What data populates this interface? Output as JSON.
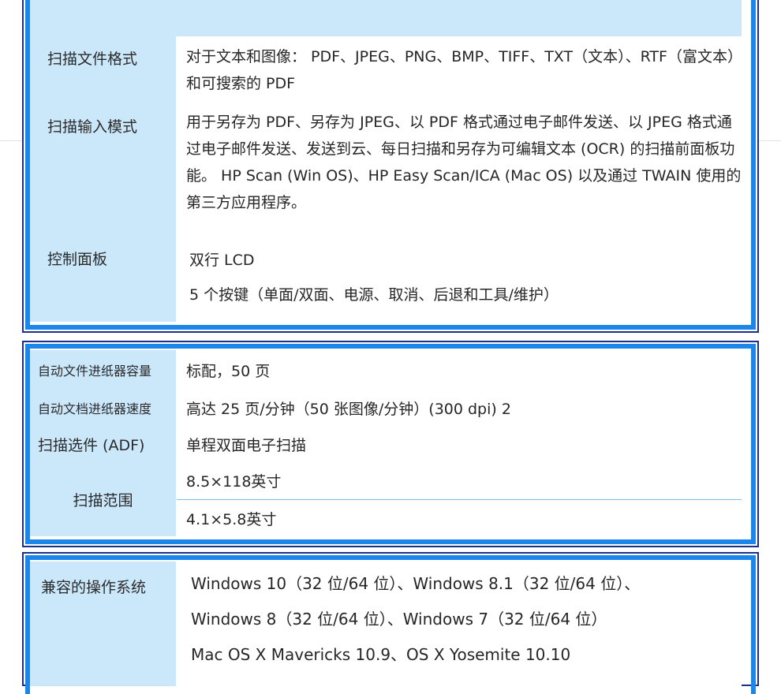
{
  "spec_panel_1": {
    "scan_file_format": {
      "label": "扫描文件格式",
      "value": "对于文本和图像： PDF、JPEG、PNG、BMP、TIFF、TXT（文本）、RTF（富文本）和可搜索的 PDF"
    },
    "scan_input_mode": {
      "label": "扫描输入模式",
      "value": "用于另存为 PDF、另存为 JPEG、以 PDF 格式通过电子邮件发送、以 JPEG 格式通过电子邮件发送、发送到云、每日扫描和另存为可编辑文本 (OCR) 的扫描前面板功能。 HP Scan (Win OS)、HP Easy Scan/ICA (Mac OS) 以及通过 TWAIN 使用的第三方应用程序。"
    },
    "control_panel": {
      "label": "控制面板",
      "lines": [
        "双行 LCD",
        "5 个按键（单面/双面、电源、取消、后退和工具/维护）"
      ]
    }
  },
  "spec_panel_2": {
    "adf_capacity": {
      "label": "自动文件进纸器容量",
      "value": "标配，50 页"
    },
    "adf_speed": {
      "label": "自动文档进纸器速度",
      "value": "高达 25 页/分钟（50 张图像/分钟）(300 dpi) 2"
    },
    "scan_option": {
      "label": "扫描选件 (ADF)",
      "value": "单程双面电子扫描"
    },
    "scan_range": {
      "label": "扫描范围",
      "values": [
        "8.5×118英寸",
        "4.1×5.8英寸"
      ]
    }
  },
  "spec_panel_3": {
    "compatible_os": {
      "label": "兼容的操作系统",
      "lines": [
        "Windows 10（32 位/64 位）、Windows 8.1（32 位/64 位）、",
        "Windows 8（32 位/64 位）、Windows 7（32 位/64 位）",
        "Mac OS X Mavericks 10.9、OS X Yosemite 10.10"
      ]
    }
  },
  "colors": {
    "frame_outer": "#1b2f8a",
    "frame_inner": "#1c86ea",
    "label_background": "#cbe8fb",
    "row_divider": "#7fc0ee"
  }
}
